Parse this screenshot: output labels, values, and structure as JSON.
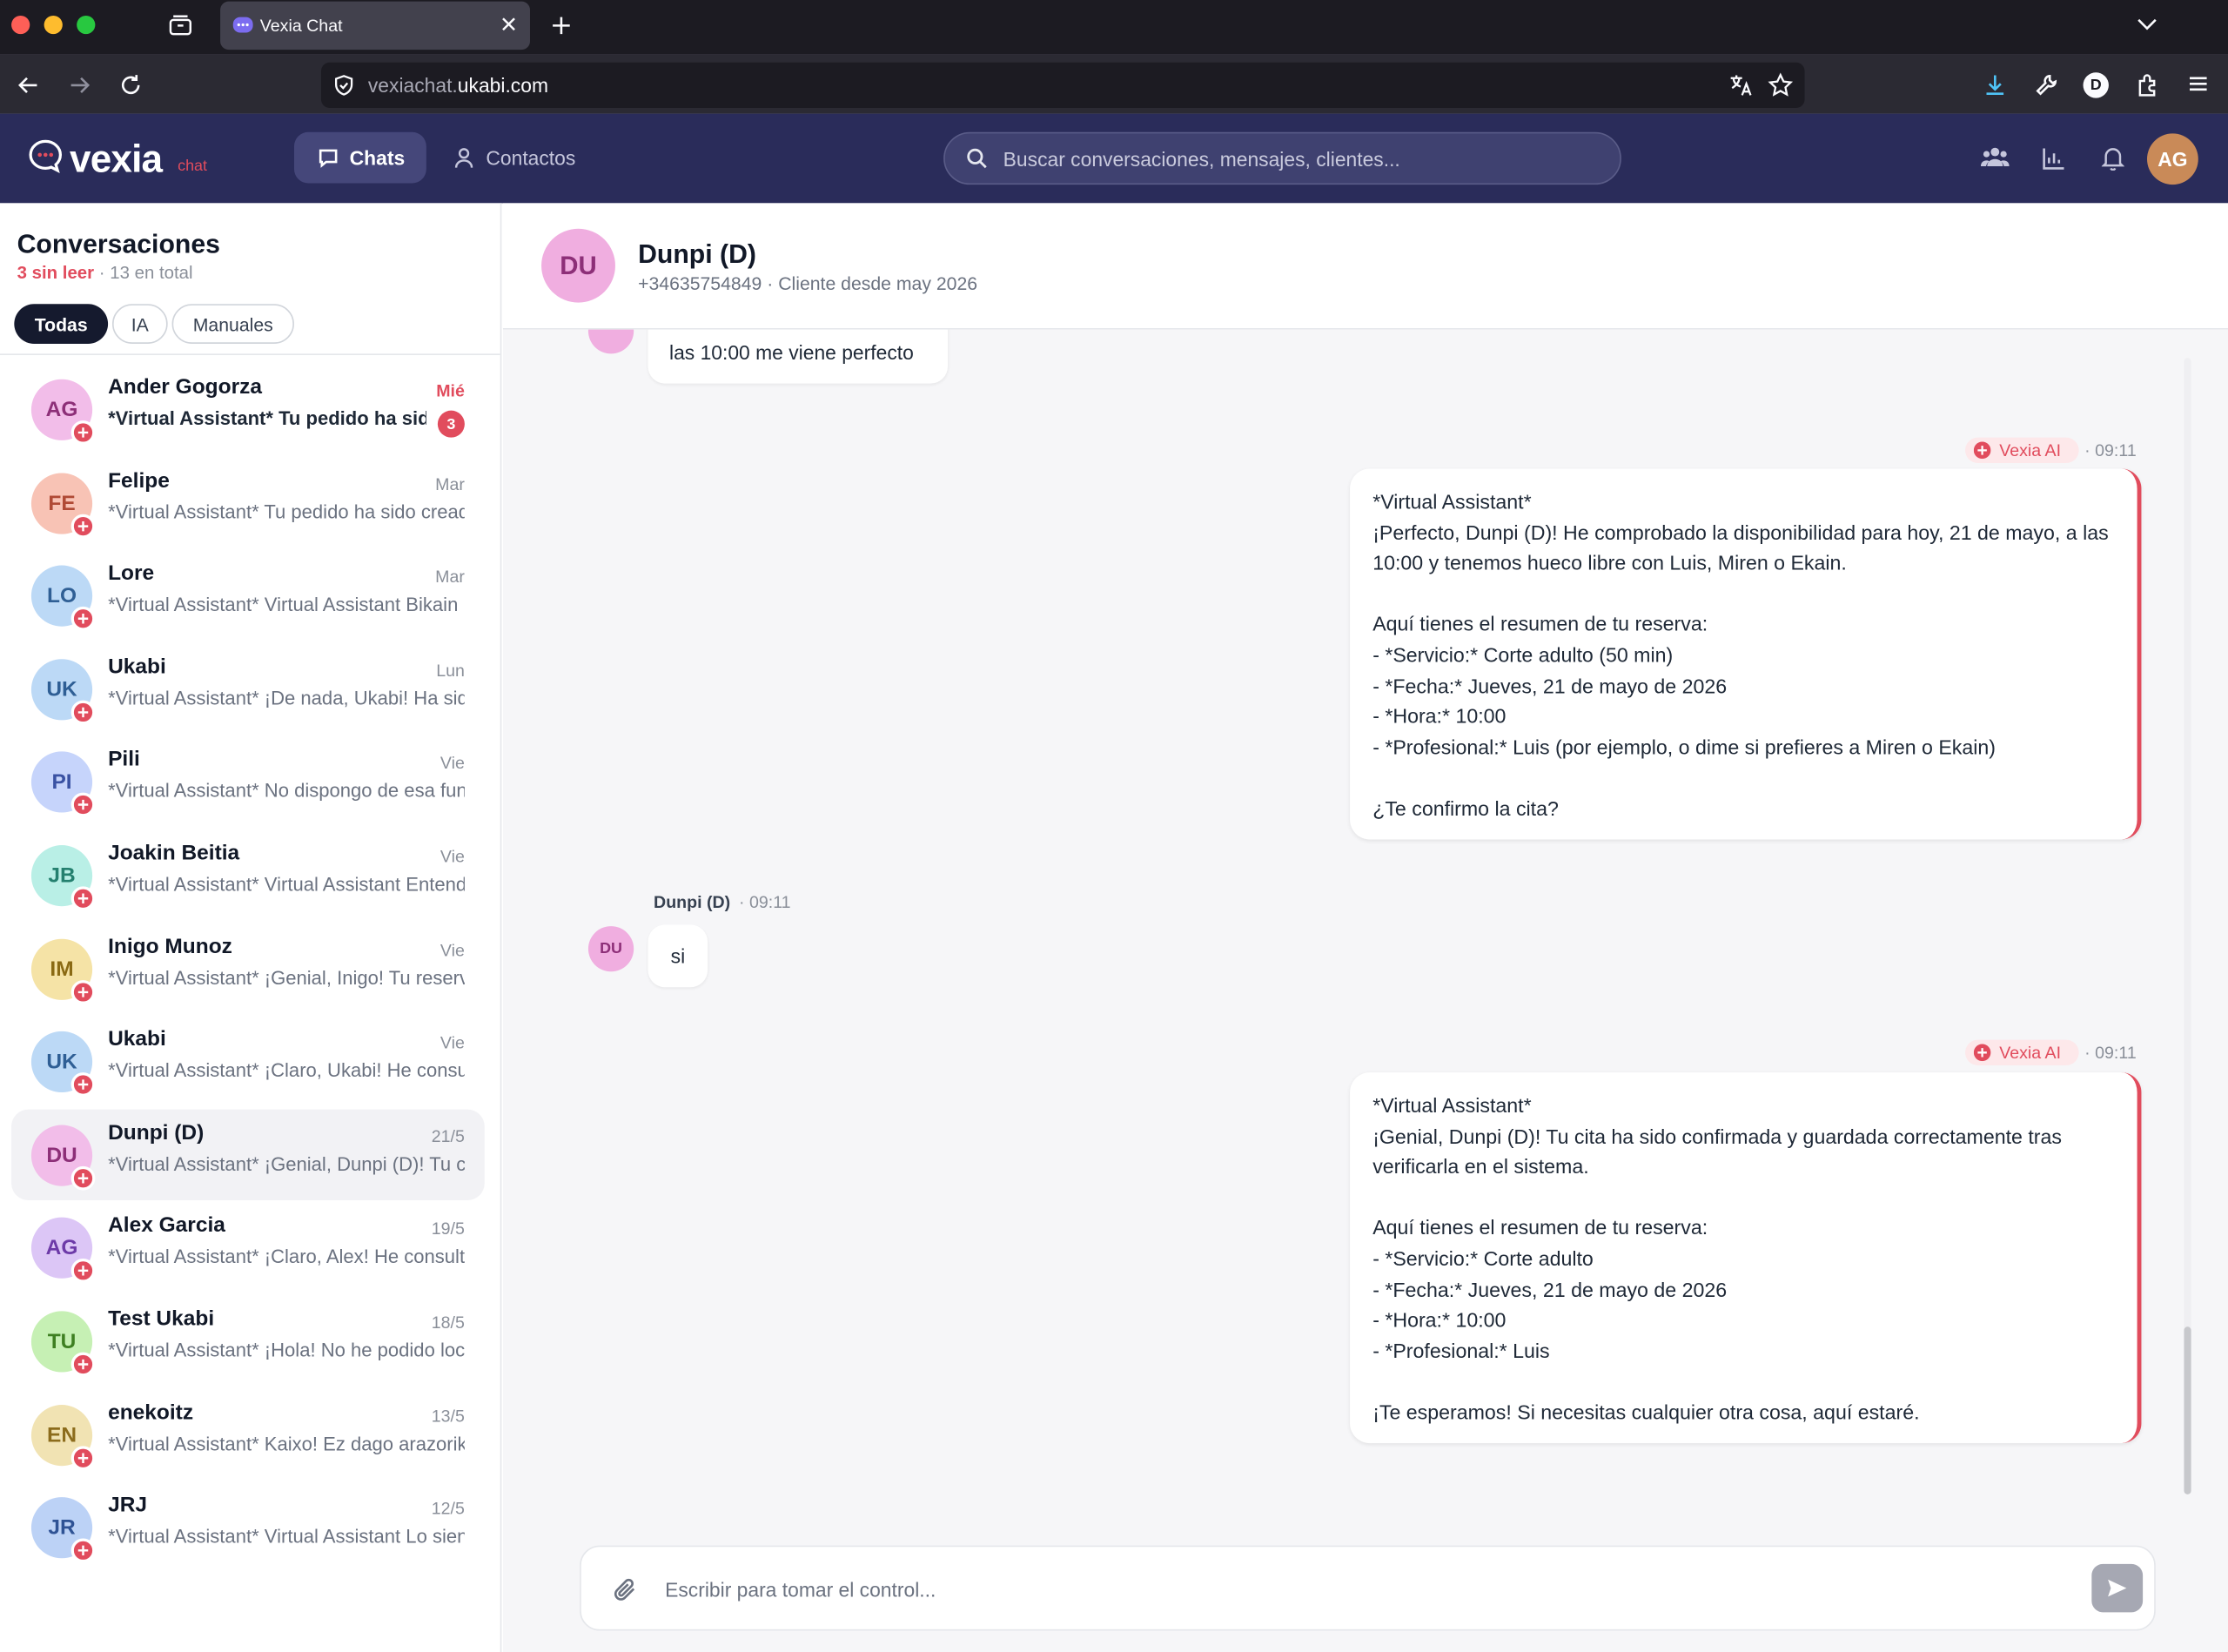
{
  "browser": {
    "tab_title": "Vexia Chat",
    "url_host": "vexiachat.",
    "url_domain": "ukabi.com",
    "profile_initial": "D"
  },
  "app": {
    "logo_text": "vexia",
    "logo_sub": "chat",
    "nav": [
      {
        "label": "Chats"
      },
      {
        "label": "Contactos"
      }
    ],
    "search_placeholder": "Buscar conversaciones, mensajes, clientes...",
    "user_initials": "AG"
  },
  "sidebar": {
    "title": "Conversaciones",
    "unread_text": "3 sin leer",
    "total_text": "· 13 en total",
    "filters": [
      {
        "label": "Todas"
      },
      {
        "label": "IA"
      },
      {
        "label": "Manuales"
      }
    ],
    "conversations": [
      {
        "initials": "AG",
        "name": "Ander Gogorza",
        "date": "Mié",
        "preview": "*Virtual Assistant* Tu pedido ha sido creado",
        "unread": "3"
      },
      {
        "initials": "FE",
        "name": "Felipe",
        "date": "Mar",
        "preview": "*Virtual Assistant* Tu pedido ha sido creado"
      },
      {
        "initials": "LO",
        "name": "Lore",
        "date": "Mar",
        "preview": "*Virtual Assistant* Virtual Assistant Bikain"
      },
      {
        "initials": "UK",
        "name": "Ukabi",
        "date": "Lun",
        "preview": "*Virtual Assistant* ¡De nada, Ukabi! Ha sido"
      },
      {
        "initials": "PI",
        "name": "Pili",
        "date": "Vie",
        "preview": "*Virtual Assistant* No dispongo de esa función"
      },
      {
        "initials": "JB",
        "name": "Joakin Beitia",
        "date": "Vie",
        "preview": "*Virtual Assistant* Virtual Assistant Entendido"
      },
      {
        "initials": "IM",
        "name": "Inigo Munoz",
        "date": "Vie",
        "preview": "*Virtual Assistant* ¡Genial, Inigo! Tu reserva"
      },
      {
        "initials": "UK",
        "name": "Ukabi",
        "date": "Vie",
        "preview": "*Virtual Assistant* ¡Claro, Ukabi! He consultado"
      },
      {
        "initials": "DU",
        "name": "Dunpi (D)",
        "date": "21/5",
        "preview": "*Virtual Assistant* ¡Genial, Dunpi (D)! Tu cita"
      },
      {
        "initials": "AG",
        "name": "Alex Garcia",
        "date": "19/5",
        "preview": "*Virtual Assistant* ¡Claro, Alex! He consultado"
      },
      {
        "initials": "TU",
        "name": "Test Ukabi",
        "date": "18/5",
        "preview": "*Virtual Assistant* ¡Hola! No he podido localizar"
      },
      {
        "initials": "EN",
        "name": "enekoitz",
        "date": "13/5",
        "preview": "*Virtual Assistant* Kaixo! Ez dago arazorik"
      },
      {
        "initials": "JR",
        "name": "JRJ",
        "date": "12/5",
        "preview": "*Virtual Assistant* Virtual Assistant Lo siento"
      }
    ]
  },
  "chat": {
    "contact_initials": "DU",
    "contact_name": "Dunpi (D)",
    "contact_meta": "+34635754849 · Cliente desde may 2026",
    "partial_message": "las 10:00 me viene perfecto",
    "messages": [
      {
        "sender": "Vexia AI",
        "time": "· 09:11",
        "text": "*Virtual Assistant*\n¡Perfecto, Dunpi (D)! He comprobado la disponibilidad para hoy, 21 de mayo, a las 10:00 y tenemos hueco libre con Luis, Miren o Ekain.\n\nAquí tienes el resumen de tu reserva:\n- *Servicio:* Corte adulto (50 min)\n- *Fecha:* Jueves, 21 de mayo de 2026\n- *Hora:* 10:00\n- *Profesional:* Luis (por ejemplo, o dime si prefieres a Miren o Ekain)\n\n¿Te confirmo la cita?"
      },
      {
        "sender": "Dunpi (D)",
        "initials": "DU",
        "time": "· 09:11",
        "text": "si"
      },
      {
        "sender": "Vexia AI",
        "time": "· 09:11",
        "text": "*Virtual Assistant*\n¡Genial, Dunpi (D)! Tu cita ha sido confirmada y guardada correctamente tras verificarla en el sistema.\n\nAquí tienes el resumen de tu reserva:\n- *Servicio:* Corte adulto\n- *Fecha:* Jueves, 21 de mayo de 2026\n- *Hora:* 10:00\n- *Profesional:* Luis\n\n¡Te esperamos! Si necesitas cualquier otra cosa, aquí estaré."
      }
    ],
    "composer_placeholder": "Escribir para tomar el control..."
  },
  "colors": {
    "header_bg": "#2a2c5a",
    "accent_red": "#e14c5d",
    "sidebar_selected": "#f2f2f5",
    "chat_bg": "#f6f6f8"
  },
  "icons": [
    "paperclip-icon",
    "send-icon",
    "search-icon",
    "team-icon",
    "stats-icon",
    "bell-icon",
    "sparkle-icon"
  ]
}
